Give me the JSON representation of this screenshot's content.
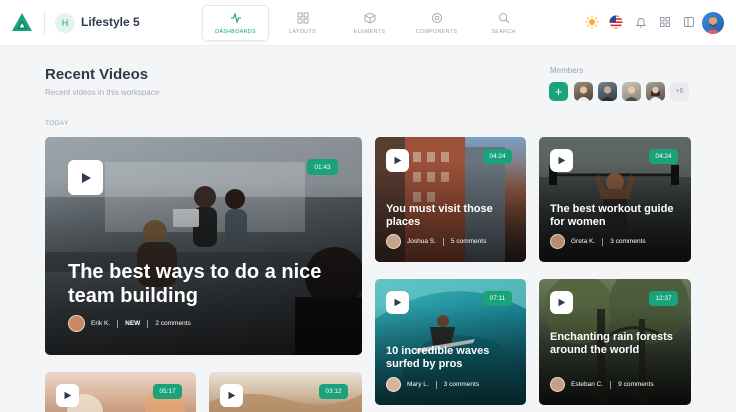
{
  "header": {
    "workspace_initial": "H",
    "workspace_name": "Lifestyle 5",
    "nav": [
      {
        "label": "DASHBOARDS",
        "icon": "activity-icon",
        "active": true
      },
      {
        "label": "LAYOUTS",
        "icon": "grid-icon",
        "active": false
      },
      {
        "label": "ELEMENTS",
        "icon": "box-icon",
        "active": false
      },
      {
        "label": "COMPONENTS",
        "icon": "components-icon",
        "active": false
      },
      {
        "label": "SEARCH",
        "icon": "search-icon",
        "active": false
      }
    ]
  },
  "page": {
    "title": "Recent Videos",
    "subtitle": "Recent videos in this workspace",
    "members_label": "Members",
    "add_member": "+",
    "members_more": "+6",
    "section_label": "TODAY"
  },
  "videos": [
    {
      "title": "The best ways to do a nice team building",
      "duration": "01:43",
      "author": "Erik K.",
      "badge": "NEW",
      "comments": "2 comments"
    },
    {
      "title": "You must visit those places",
      "duration": "04:24",
      "author": "Joshua S.",
      "comments": "5 comments"
    },
    {
      "title": "The best workout guide for women",
      "duration": "04:24",
      "author": "Greta K.",
      "comments": "3 comments"
    },
    {
      "title": "10 incredible waves surfed by pros",
      "duration": "07:11",
      "author": "Mary L.",
      "comments": "3 comments"
    },
    {
      "title": "Enchanting rain forests around the world",
      "duration": "12:37",
      "author": "Esteban C.",
      "comments": "9 comments"
    },
    {
      "title": "",
      "duration": "05:17"
    },
    {
      "title": "",
      "duration": "03:12"
    }
  ],
  "colors": {
    "accent": "#1aa37a",
    "title": "#2f3b4c",
    "muted": "#a6adb8",
    "background": "#f4f5f7"
  }
}
